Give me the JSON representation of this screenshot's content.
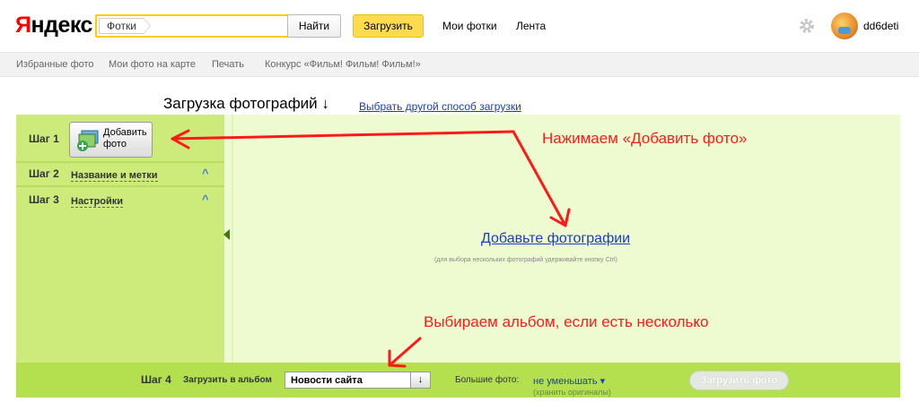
{
  "header": {
    "logo_first": "Я",
    "logo_rest": "ндекс",
    "search_tag": "Фотки",
    "search_placeholder": "",
    "search_button": "Найти",
    "upload_button": "Загрузить",
    "nav": [
      "Мои фотки",
      "Лента"
    ],
    "gear_icon": "gear-icon",
    "username": "dd6deti"
  },
  "subnav": {
    "items": [
      "Избранные фото",
      "Мои фото на карте",
      "Печать",
      "Конкурс «Фильм! Фильм! Фильм!»"
    ]
  },
  "page": {
    "title": "Загрузка фотографий ↓",
    "alt_link": "Выбрать другой способ загрузки"
  },
  "steps": {
    "step1": {
      "label": "Шаг 1",
      "button_line1": "Добавить",
      "button_line2": "фото"
    },
    "step2": {
      "label": "Шаг 2",
      "link": "Название и метки"
    },
    "step3": {
      "label": "Шаг 3",
      "link": "Настройки"
    }
  },
  "dropzone": {
    "link": "Добавьте фотографии",
    "hint": "(для выбора нескольких фотографий удерживайте кнопку Ctrl)"
  },
  "annotations": {
    "add_photo": "Нажимаем «Добавить фото»",
    "choose_album": "Выбираем альбом, если есть несколько",
    "color": "#ff1a1a"
  },
  "bottom": {
    "step4_label": "Шаг 4",
    "album_label": "Загрузить в альбом",
    "album_value": "Новости сайта",
    "large_label": "Большие фото:",
    "large_value": "не уменьшать ▾",
    "large_hint": "(хранить оригиналы)",
    "submit": "Загрузить фото"
  },
  "colors": {
    "accent_yellow": "#ffdb4d",
    "panel_green": "#eefbd0",
    "sidebar_green": "#cceb7b",
    "bar_green": "#b4e04f",
    "link_blue": "#1a3dc1"
  }
}
